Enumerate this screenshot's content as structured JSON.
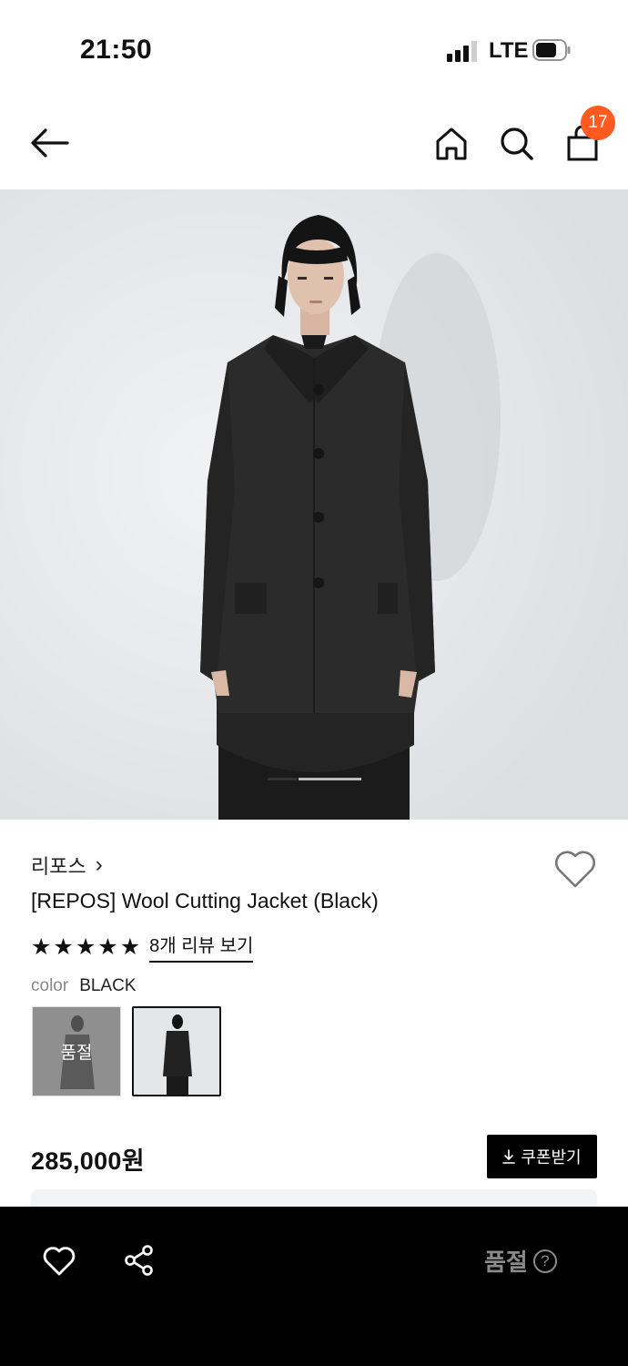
{
  "status_bar": {
    "time": "21:50",
    "network": "LTE",
    "icons": [
      "signal-icon",
      "battery-icon"
    ]
  },
  "nav": {
    "icons": [
      "back-arrow-icon",
      "home-icon",
      "search-icon",
      "bag-icon"
    ],
    "cart_count": "17"
  },
  "gallery": {
    "current_slide": 1,
    "total_slides": 2,
    "indicator_color": "#333333"
  },
  "product": {
    "brand": "리포스",
    "brand_chevron": "›",
    "title": "[REPOS] Wool Cutting Jacket (Black)",
    "rating_stars": 5,
    "review_link": "8개 리뷰 보기",
    "color_label": "color",
    "color_value": "BLACK",
    "swatches": [
      {
        "status": "품절"
      },
      {
        "status": ""
      }
    ],
    "price": "285,000원",
    "coupon_button": "쿠폰받기"
  },
  "bottom_bar": {
    "icons": [
      "heart-icon",
      "share-icon"
    ],
    "soldout_label": "품절",
    "help_symbol": "?"
  },
  "colors": {
    "accent_badge": "#ff5a1f",
    "bar_bg": "#000000",
    "disabled_text": "#8a8a8a"
  }
}
